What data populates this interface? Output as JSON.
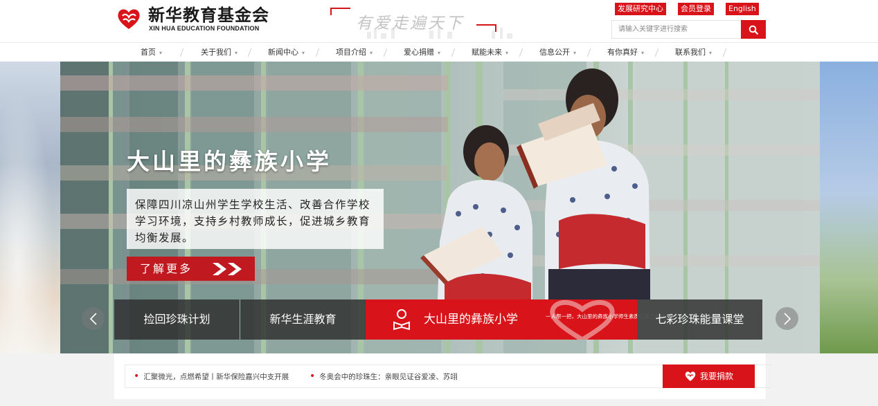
{
  "header": {
    "logo_cn": "新华教育基金会",
    "logo_en": "XIN HUA EDUCATION FOUNDATION",
    "slogan": "有爱走遍天下",
    "top_links": [
      "发展研究中心",
      "会员登录",
      "English"
    ],
    "search": {
      "placeholder": "请输入关键字进行搜索"
    }
  },
  "nav": {
    "items": [
      {
        "label": "首页"
      },
      {
        "label": "关于我们"
      },
      {
        "label": "新闻中心"
      },
      {
        "label": "项目介绍"
      },
      {
        "label": "爱心捐赠"
      },
      {
        "label": "赋能未来"
      },
      {
        "label": "信息公开"
      },
      {
        "label": "有你真好"
      },
      {
        "label": "联系我们"
      }
    ]
  },
  "banner": {
    "title": "大山里的彝族小学",
    "description": "保障四川凉山州学生学校生活、改善合作学校学习环境，支持乡村教师成长，促进城乡教育均衡发展。",
    "more_label": "了解更多",
    "tabs": [
      {
        "label": "捡回珍珠计划"
      },
      {
        "label": "新华生涯教育"
      },
      {
        "label": "大山里的彝族小学",
        "subtitle": "一人帮一把，大山里的彝族小学师生素质与能力双提升"
      },
      {
        "label": "七彩珍珠能量课堂"
      }
    ]
  },
  "news": {
    "items": [
      "汇聚微光，点燃希望丨新华保险嘉兴中支开展",
      "冬奥会中的珍珠生：亲眼见证谷爱凌、苏翊"
    ],
    "donate_label": "我要捐款"
  },
  "colors": {
    "brand_red": "#d8141a",
    "dark_tab": "#2d2d2d"
  }
}
